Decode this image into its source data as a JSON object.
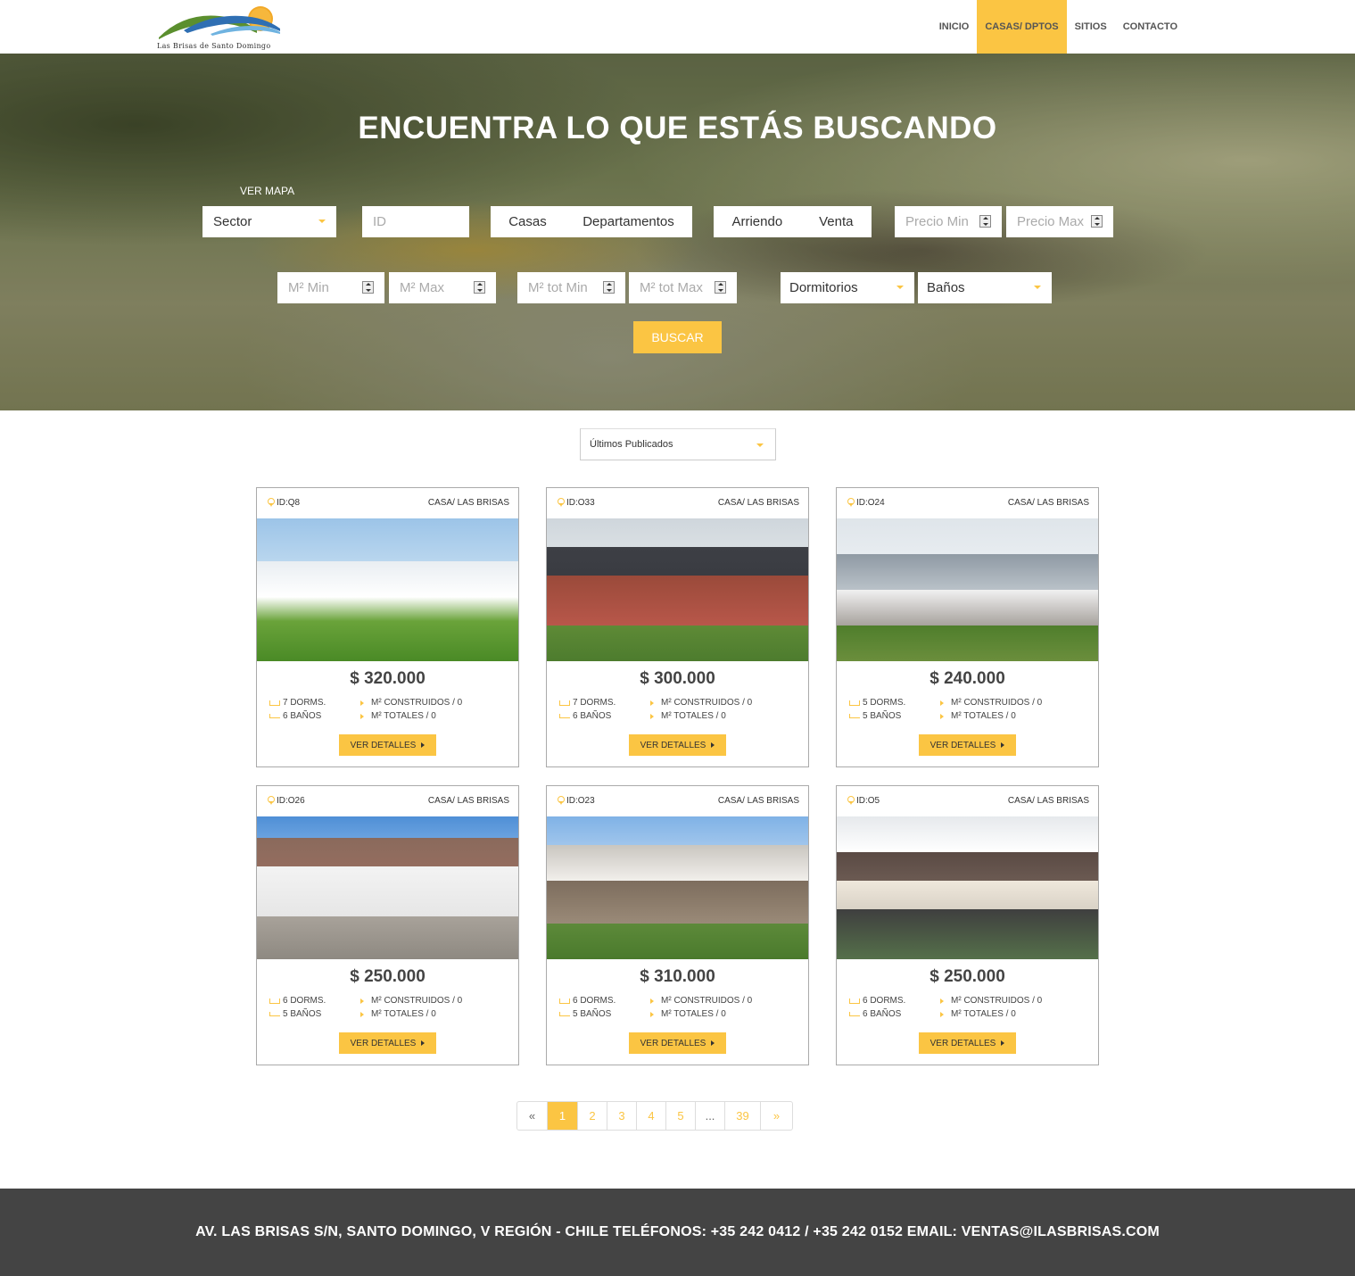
{
  "header": {
    "logo_text": "Las Brisas de Santo Domingo",
    "nav": [
      "INICIO",
      "CASAS/ DPTOS",
      "SITIOS",
      "CONTACTO"
    ],
    "nav_active_index": 1
  },
  "hero": {
    "title": "ENCUENTRA LO QUE ESTÁS BUSCANDO",
    "ver_mapa": "VER MAPA",
    "sector": "Sector",
    "id_placeholder": "ID",
    "tipo": [
      "Casas",
      "Departamentos"
    ],
    "operacion": [
      "Arriendo",
      "Venta"
    ],
    "precio_min": "Precio Min",
    "precio_max": "Precio Max",
    "m2_min": "M² Min",
    "m2_max": "M² Max",
    "m2_tot_min": "M² tot Min",
    "m2_tot_max": "M² tot Max",
    "dormitorios": "Dormitorios",
    "banos": "Baños",
    "buscar": "BUSCAR"
  },
  "sort": {
    "selected": "Últimos Publicados"
  },
  "listings": [
    {
      "id": "ID:Q8",
      "type": "CASA/ LAS BRISAS",
      "price": "$ 320.000",
      "dorms": "7 DORMS.",
      "banos": "6 BAÑOS",
      "m2c": "M² CONSTRUIDOS / 0",
      "m2t": "M² TOTALES / 0",
      "cta": "VER DETALLES"
    },
    {
      "id": "ID:O33",
      "type": "CASA/ LAS BRISAS",
      "price": "$ 300.000",
      "dorms": "7 DORMS.",
      "banos": "6 BAÑOS",
      "m2c": "M² CONSTRUIDOS / 0",
      "m2t": "M² TOTALES / 0",
      "cta": "VER DETALLES"
    },
    {
      "id": "ID:O24",
      "type": "CASA/ LAS BRISAS",
      "price": "$ 240.000",
      "dorms": "5 DORMS.",
      "banos": "5 BAÑOS",
      "m2c": "M² CONSTRUIDOS / 0",
      "m2t": "M² TOTALES / 0",
      "cta": "VER DETALLES"
    },
    {
      "id": "ID:O26",
      "type": "CASA/ LAS BRISAS",
      "price": "$ 250.000",
      "dorms": "6 DORMS.",
      "banos": "5 BAÑOS",
      "m2c": "M² CONSTRUIDOS / 0",
      "m2t": "M² TOTALES / 0",
      "cta": "VER DETALLES"
    },
    {
      "id": "ID:O23",
      "type": "CASA/ LAS BRISAS",
      "price": "$ 310.000",
      "dorms": "6 DORMS.",
      "banos": "5 BAÑOS",
      "m2c": "M² CONSTRUIDOS / 0",
      "m2t": "M² TOTALES / 0",
      "cta": "VER DETALLES"
    },
    {
      "id": "ID:O5",
      "type": "CASA/ LAS BRISAS",
      "price": "$ 250.000",
      "dorms": "6 DORMS.",
      "banos": "6 BAÑOS",
      "m2c": "M² CONSTRUIDOS / 0",
      "m2t": "M² TOTALES / 0",
      "cta": "VER DETALLES"
    }
  ],
  "pagination": [
    "«",
    "1",
    "2",
    "3",
    "4",
    "5",
    "...",
    "39",
    "»"
  ],
  "pagination_active": "1",
  "footer": "AV. LAS BRISAS S/N, SANTO DOMINGO, V REGIÓN - CHILE TELÉFONOS: +35 242 0412 / +35 242 0152 EMAIL: VENTAS@ILASBRISAS.COM",
  "colors": {
    "accent": "#fbc543",
    "footer_bg": "#444444"
  }
}
